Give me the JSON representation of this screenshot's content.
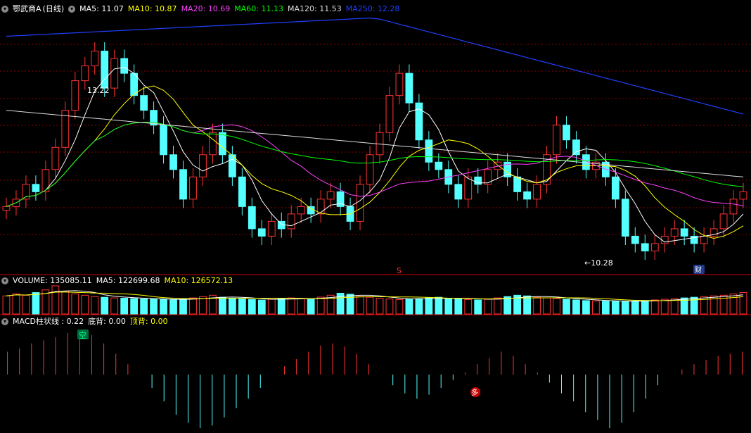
{
  "main": {
    "stock_name": "鄂武商A",
    "period": "(日线)",
    "ma_labels": [
      {
        "text": "MA5: 11.07",
        "color": "#ffffff"
      },
      {
        "text": "MA10: 10.87",
        "color": "#ffff00"
      },
      {
        "text": "MA20: 10.69",
        "color": "#ff40ff"
      },
      {
        "text": "MA60: 11.13",
        "color": "#00ff00"
      },
      {
        "text": "MA120: 11.53",
        "color": "#dddddd"
      },
      {
        "text": "MA250: 12.28",
        "color": "#2040ff"
      }
    ],
    "high_marker": "13.22",
    "low_marker": "←10.28",
    "signal_s": "S",
    "signal_cai": "财"
  },
  "volume": {
    "labels": [
      {
        "text": "VOLUME: 135085.11",
        "color": "#ffffff"
      },
      {
        "text": "MA5: 122699.68",
        "color": "#ffffff"
      },
      {
        "text": "MA10: 126572.13",
        "color": "#ffff00"
      }
    ]
  },
  "macd": {
    "labels": [
      {
        "text": "MACD柱状线 : 0.22",
        "color": "#ffffff"
      },
      {
        "text": "底背: 0.00",
        "color": "#ffffff"
      },
      {
        "text": "顶背: 0.00",
        "color": "#ffff00"
      }
    ],
    "signal_kong": "空",
    "signal_duo": "多"
  },
  "colors": {
    "up": "#ff3333",
    "down": "#54ffff",
    "grid": "#8b0000",
    "ma5": "#ffffff",
    "ma10": "#ffff00",
    "ma20": "#ff40ff",
    "ma60": "#00ff00",
    "ma120": "#dddddd",
    "ma250": "#2040ff"
  },
  "chart_data": {
    "type": "candlestick",
    "price_range": [
      10.0,
      13.5
    ],
    "candles_closes": [
      10.9,
      11.0,
      11.2,
      11.1,
      11.4,
      11.7,
      12.2,
      12.6,
      12.8,
      13.0,
      12.5,
      12.9,
      12.7,
      12.4,
      12.2,
      12.0,
      11.6,
      11.4,
      11.0,
      11.3,
      11.6,
      11.9,
      11.6,
      11.3,
      10.9,
      10.6,
      10.5,
      10.7,
      10.6,
      10.8,
      10.9,
      10.8,
      11.0,
      11.1,
      10.9,
      10.7,
      11.2,
      11.6,
      11.9,
      12.4,
      12.7,
      12.3,
      11.8,
      11.5,
      11.4,
      11.2,
      11.0,
      11.3,
      11.2,
      11.4,
      11.5,
      11.3,
      11.1,
      11.0,
      11.2,
      11.6,
      12.0,
      11.8,
      11.6,
      11.4,
      11.5,
      11.3,
      11.0,
      10.5,
      10.4,
      10.3,
      10.4,
      10.5,
      10.6,
      10.5,
      10.4,
      10.5,
      10.6,
      10.8,
      11.0,
      11.1
    ],
    "volume_values": [
      135085,
      150000,
      140000,
      160000,
      180000,
      210000,
      170000,
      150000,
      140000,
      130000,
      125000,
      120000,
      118000,
      115000,
      112000,
      110000,
      108000,
      105000,
      110000,
      120000,
      130000,
      140000,
      125000,
      118000,
      112000,
      108000,
      104000,
      110000,
      116000,
      120000,
      115000,
      112000,
      126000,
      140000,
      155000,
      148000,
      130000,
      125000,
      118000,
      112000,
      108000,
      110000,
      115000,
      120000,
      125000,
      118000,
      112000,
      108000,
      105000,
      110000,
      120000,
      130000,
      140000,
      135000,
      125000,
      120000,
      115000,
      110000,
      105000,
      100000,
      98000,
      96000,
      94000,
      92000,
      96000,
      100000,
      105000,
      110000,
      115000,
      120000,
      125000,
      130000,
      135000,
      140000,
      150000,
      160000
    ],
    "volume_ma5_label": "MA5: 122699.68",
    "macd_values": [
      0.22,
      0.25,
      0.3,
      0.33,
      0.36,
      0.4,
      0.42,
      0.38,
      0.3,
      0.2,
      0.1,
      0.0,
      -0.1,
      -0.2,
      -0.3,
      -0.36,
      -0.4,
      -0.38,
      -0.32,
      -0.25,
      -0.18,
      -0.1,
      0.0,
      0.08,
      0.15,
      0.22,
      0.28,
      0.3,
      0.27,
      0.2,
      0.1,
      0.0,
      -0.08,
      -0.14,
      -0.18,
      -0.15,
      -0.1,
      -0.04,
      0.02,
      0.1,
      0.16,
      0.22,
      0.18,
      0.1,
      0.02,
      -0.06,
      -0.14,
      -0.2,
      -0.28,
      -0.34,
      -0.4,
      -0.36,
      -0.28,
      -0.18,
      -0.08,
      0.0,
      0.05,
      0.1,
      0.14,
      0.18,
      0.2,
      0.22
    ]
  }
}
